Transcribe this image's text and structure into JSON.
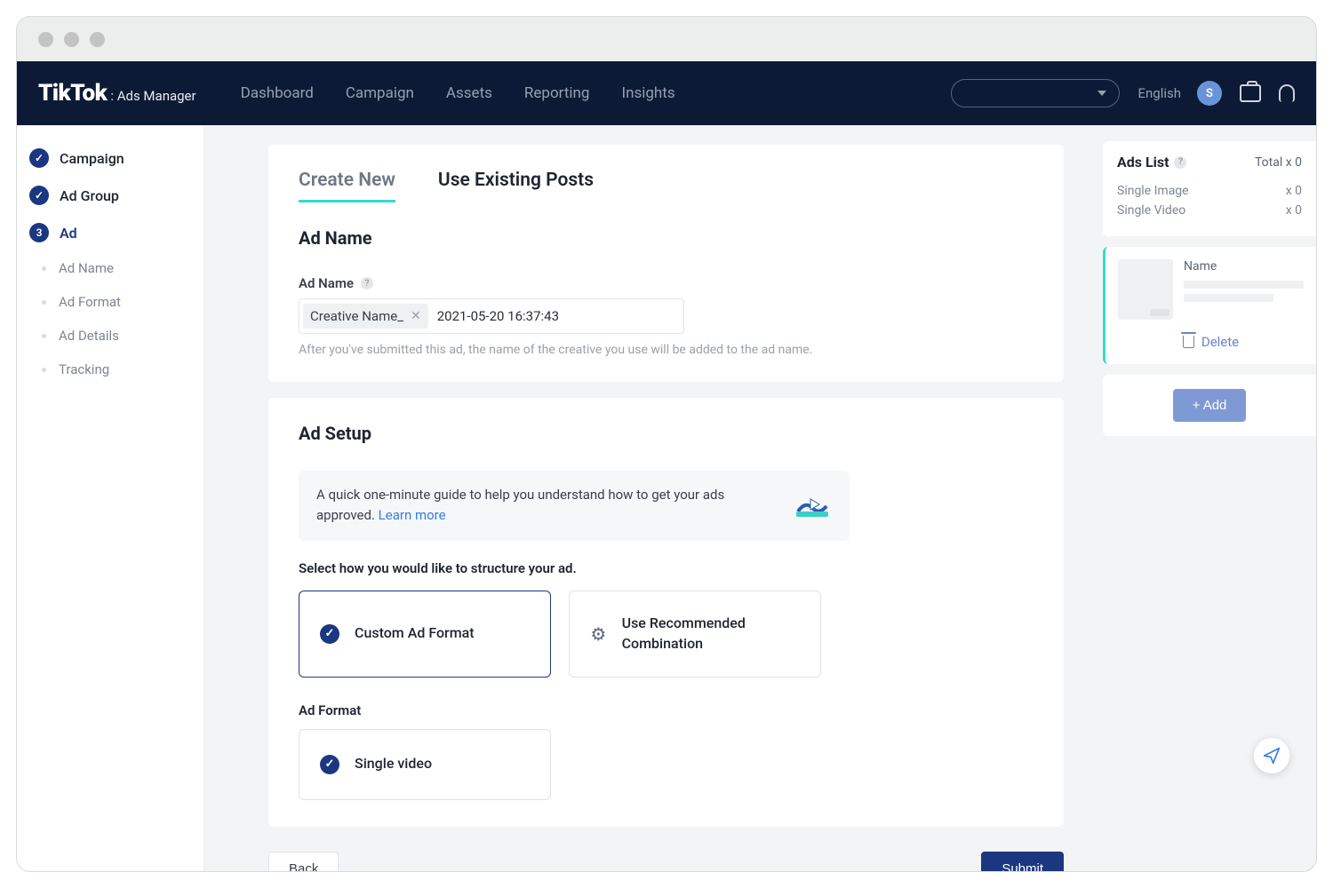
{
  "brand": {
    "main": "TikTok",
    "sub": ": Ads Manager"
  },
  "nav": {
    "items": [
      "Dashboard",
      "Campaign",
      "Assets",
      "Reporting",
      "Insights"
    ],
    "language": "English",
    "avatar_initial": "S"
  },
  "sidebar": {
    "steps": [
      {
        "label": "Campaign",
        "kind": "check"
      },
      {
        "label": "Ad Group",
        "kind": "check"
      },
      {
        "label": "Ad",
        "kind": "num",
        "num": "3"
      }
    ],
    "subs": [
      "Ad Name",
      "Ad Format",
      "Ad Details",
      "Tracking"
    ]
  },
  "tabs": {
    "create": "Create New",
    "existing": "Use Existing Posts"
  },
  "adname": {
    "section_title": "Ad Name",
    "field_label": "Ad Name",
    "chip": "Creative Name_",
    "date": "2021-05-20 16:37:43",
    "hint": "After you've submitted this ad, the name of the creative you use will be added to the ad name."
  },
  "adsetup": {
    "title": "Ad Setup",
    "guide": "A quick one-minute guide to help you understand how to get your ads approved.",
    "learn_more": "Learn more",
    "structure_label": "Select how you would like to structure your ad.",
    "option_custom": "Custom Ad Format",
    "option_recommended": "Use Recommended Combination",
    "ad_format_label": "Ad Format",
    "format_single_video": "Single video"
  },
  "footer": {
    "back": "Back",
    "submit": "Submit"
  },
  "adslist": {
    "title": "Ads List",
    "total_label": "Total x 0",
    "rows": [
      {
        "label": "Single Image",
        "count": "x 0"
      },
      {
        "label": "Single Video",
        "count": "x 0"
      }
    ],
    "preview_name": "Name",
    "delete": "Delete",
    "add": "+ Add"
  }
}
